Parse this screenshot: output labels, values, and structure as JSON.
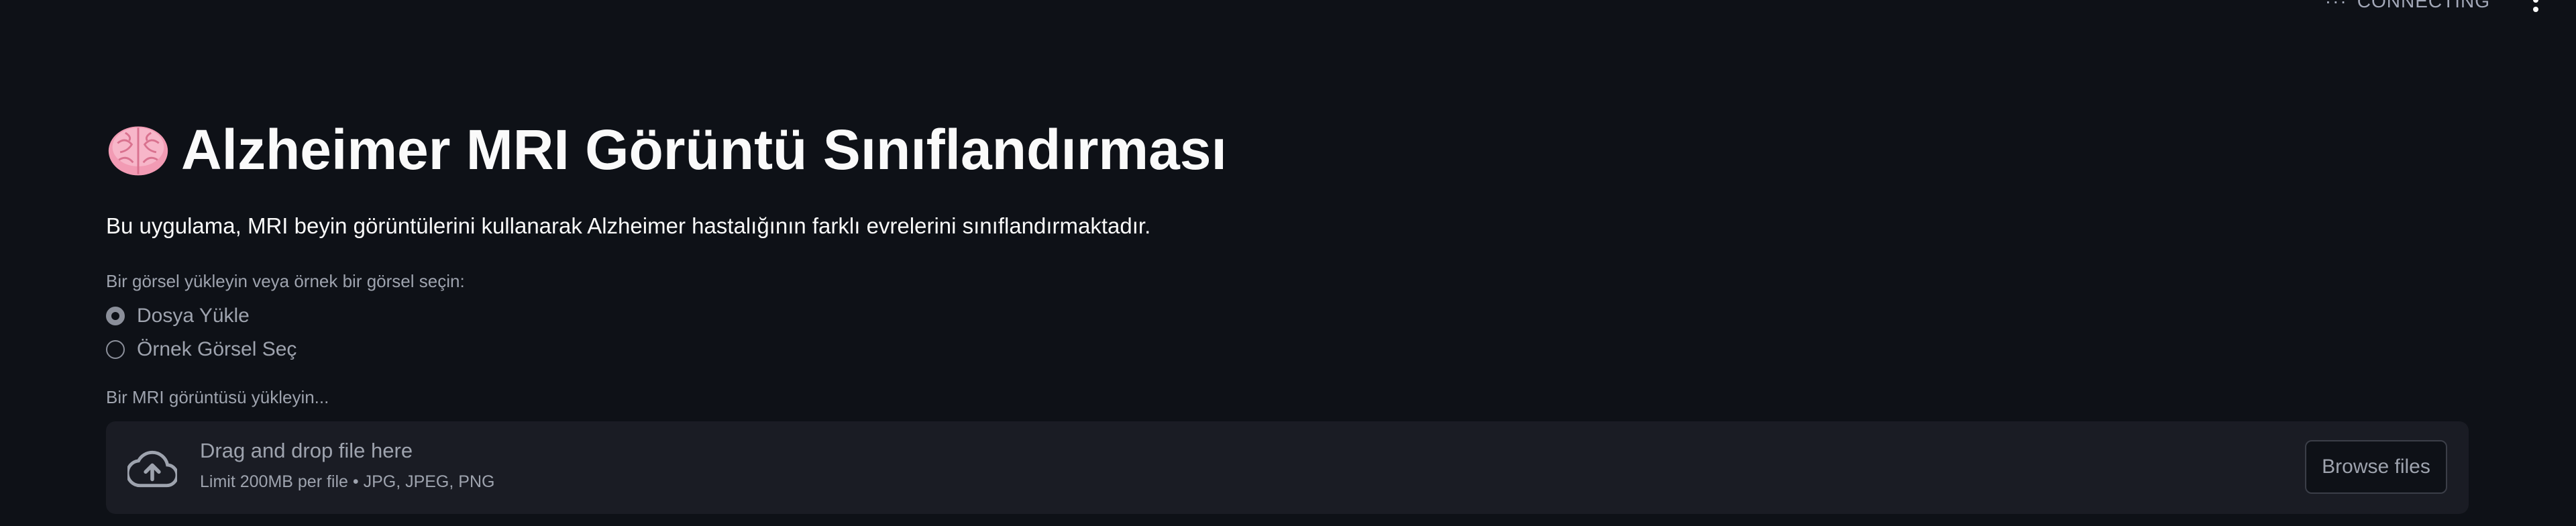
{
  "header": {
    "status_text": "CONNECTING",
    "status_icon": "connecting-dots-icon",
    "menu_icon": "kebab-menu-icon"
  },
  "main": {
    "title_icon": "brain-icon",
    "title": "Alzheimer MRI Görüntü Sınıflandırması",
    "description": "Bu uygulama, MRI beyin görüntülerini kullanarak Alzheimer hastalığının farklı evrelerini sınıflandırmaktadır.",
    "radio": {
      "label": "Bir görsel yükleyin veya örnek bir görsel seçin:",
      "options": [
        {
          "label": "Dosya Yükle",
          "selected": true
        },
        {
          "label": "Örnek Görsel Seç",
          "selected": false
        }
      ]
    },
    "uploader": {
      "label": "Bir MRI görüntüsü yükleyin...",
      "icon": "cloud-upload-icon",
      "drop_text": "Drag and drop file here",
      "limit_text": "Limit 200MB per file • JPG, JPEG, PNG",
      "browse_label": "Browse files"
    }
  },
  "colors": {
    "background": "#0e1117",
    "text": "#fafafa",
    "muted": "#9ea3ae",
    "dropzone": "#1a1c24",
    "brain": "#f4a0b8"
  }
}
